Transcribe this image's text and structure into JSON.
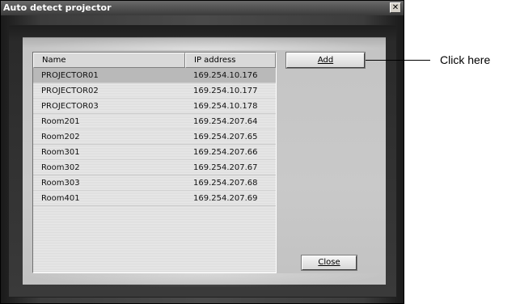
{
  "window": {
    "title": "Auto detect projector",
    "close_symbol": "✕"
  },
  "table": {
    "columns": [
      "Name",
      "IP address"
    ],
    "rows": [
      {
        "name": "PROJECTOR01",
        "ip": "169.254.10.176",
        "selected": true
      },
      {
        "name": "PROJECTOR02",
        "ip": "169.254.10.177"
      },
      {
        "name": "PROJECTOR03",
        "ip": "169.254.10.178"
      },
      {
        "name": "Room201",
        "ip": "169.254.207.64"
      },
      {
        "name": "Room202",
        "ip": "169.254.207.65"
      },
      {
        "name": "Room301",
        "ip": "169.254.207.66"
      },
      {
        "name": "Room302",
        "ip": "169.254.207.67"
      },
      {
        "name": "Room303",
        "ip": "169.254.207.68"
      },
      {
        "name": "Room401",
        "ip": "169.254.207.69"
      }
    ]
  },
  "buttons": {
    "add_label": "Add",
    "close_label": "Close"
  },
  "annotation": {
    "text": "Click here"
  }
}
